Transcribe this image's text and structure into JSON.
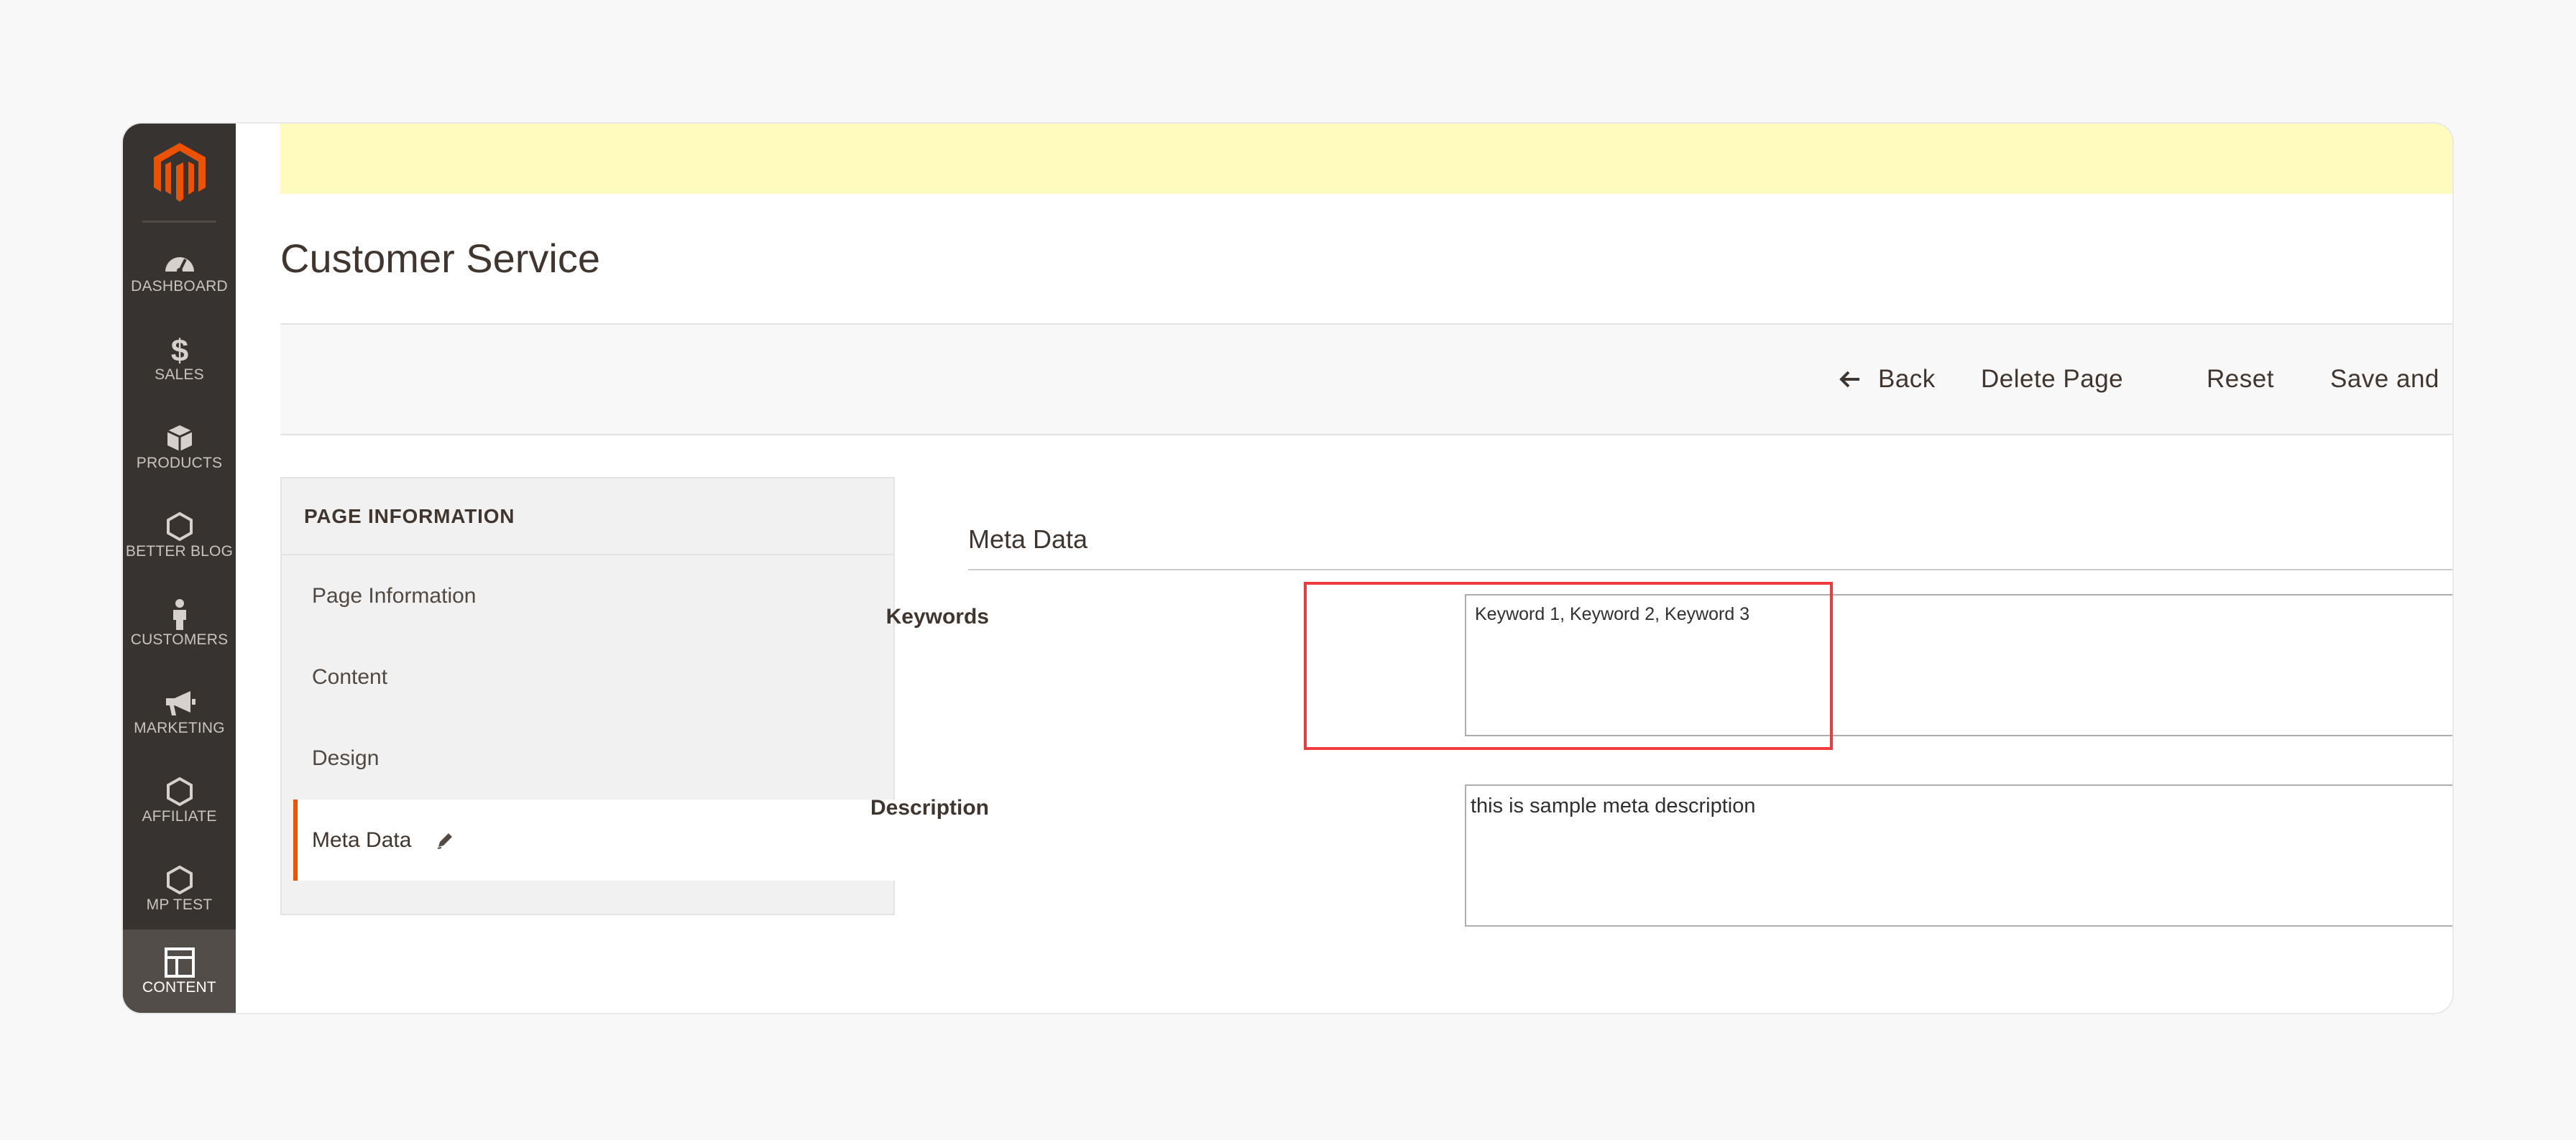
{
  "sidebar": {
    "items": [
      {
        "label": "DASHBOARD",
        "icon": "dashboard-gauge-icon"
      },
      {
        "label": "SALES",
        "icon": "dollar-icon"
      },
      {
        "label": "PRODUCTS",
        "icon": "box-icon"
      },
      {
        "label": "BETTER BLOG",
        "icon": "hexagon-icon"
      },
      {
        "label": "CUSTOMERS",
        "icon": "person-icon"
      },
      {
        "label": "MARKETING",
        "icon": "megaphone-icon"
      },
      {
        "label": "AFFILIATE",
        "icon": "hexagon-icon"
      },
      {
        "label": "MP TEST",
        "icon": "hexagon-icon"
      },
      {
        "label": "CONTENT",
        "icon": "layout-icon"
      }
    ],
    "active": "CONTENT"
  },
  "page": {
    "title": "Customer Service"
  },
  "actions": {
    "back_label": "Back",
    "delete_label": "Delete Page",
    "reset_label": "Reset",
    "save_label": "Save and"
  },
  "tabs": {
    "header": "PAGE INFORMATION",
    "items": [
      "Page Information",
      "Content",
      "Design",
      "Meta Data"
    ],
    "active": "Meta Data"
  },
  "fieldset": {
    "title": "Meta Data",
    "keywords_label": "Keywords",
    "keywords_value": "Keyword 1, Keyword 2, Keyword 3",
    "description_label": "Description",
    "description_value": "this is sample meta description"
  },
  "colors": {
    "sidebar_bg": "#373330",
    "sidebar_active_bg": "#524d49",
    "logo": "#eb5202",
    "notice_bg": "#fffbbf",
    "highlight": "#ef3b3f"
  }
}
